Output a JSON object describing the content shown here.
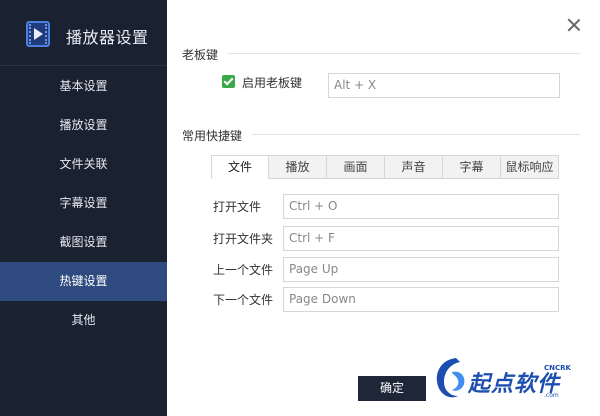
{
  "app": {
    "title": "播放器设置"
  },
  "sidebar": {
    "items": [
      {
        "label": "基本设置"
      },
      {
        "label": "播放设置"
      },
      {
        "label": "文件关联"
      },
      {
        "label": "字幕设置"
      },
      {
        "label": "截图设置"
      },
      {
        "label": "热键设置",
        "active": true
      },
      {
        "label": "其他"
      }
    ]
  },
  "boss_key": {
    "section_title": "老板键",
    "checkbox_label": "启用老板键",
    "checked": true,
    "value": "Alt + X"
  },
  "hotkeys": {
    "section_title": "常用快捷键",
    "tabs": [
      "文件",
      "播放",
      "画面",
      "声音",
      "字幕",
      "鼠标响应"
    ],
    "active_tab": "文件",
    "rows": [
      {
        "label": "打开文件",
        "value": "Ctrl + O"
      },
      {
        "label": "打开文件夹",
        "value": "Ctrl + F"
      },
      {
        "label": "上一个文件",
        "value": "Page Up"
      },
      {
        "label": "下一个文件",
        "value": "Page Down"
      }
    ]
  },
  "footer": {
    "ok_label": "确定"
  },
  "watermark": {
    "text": "起点软件",
    "sub": "CNCRK",
    "domain": ".com"
  },
  "colors": {
    "sidebar_bg": "#1a2130",
    "active_nav": "#2e4a7e",
    "check_green": "#3aa94a",
    "ok_button": "#1e2638"
  }
}
